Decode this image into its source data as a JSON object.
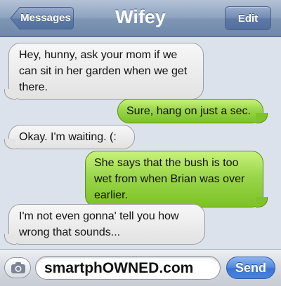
{
  "navbar": {
    "back_label": "Messages",
    "title": "Wifey",
    "edit_label": "Edit"
  },
  "messages": [
    {
      "direction": "incoming",
      "text": "Hey, hunny, ask your mom if we can sit in her garden when we get there."
    },
    {
      "direction": "outgoing",
      "text": "Sure, hang on just a sec."
    },
    {
      "direction": "incoming",
      "text": "Okay. I'm waiting. (:"
    },
    {
      "direction": "outgoing",
      "text": "She says that the bush is too wet from when Brian was over earlier."
    },
    {
      "direction": "incoming",
      "text": "I'm not even gonna' tell you how wrong that sounds..."
    }
  ],
  "composer": {
    "camera_icon": "camera-icon",
    "input_value": "smartphOWNED.com",
    "send_label": "Send"
  },
  "colors": {
    "incoming_bubble": "#e8e8e8",
    "outgoing_bubble": "#8fd03f",
    "navbar": "#8ea3bf",
    "send_button": "#4a84de"
  }
}
